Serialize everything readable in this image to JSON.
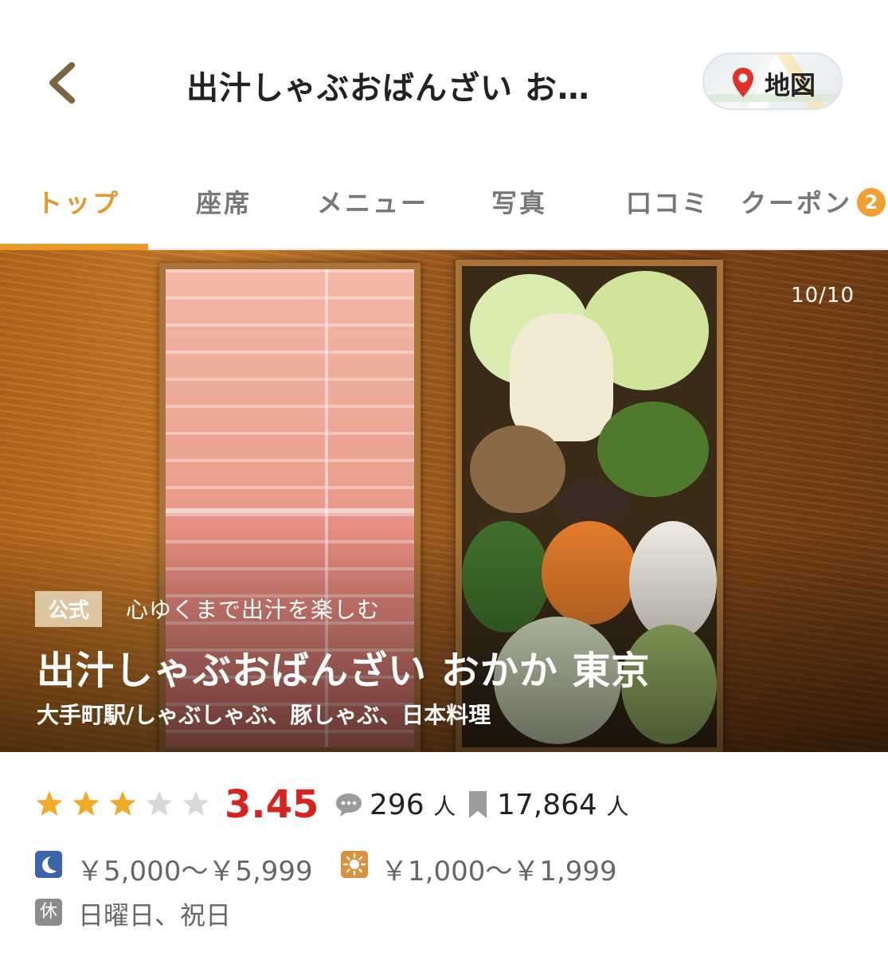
{
  "header": {
    "title": "出汁しゃぶおばんざい お…",
    "map_label": "地図"
  },
  "tabs": [
    {
      "label": "トップ",
      "active": true
    },
    {
      "label": "座席"
    },
    {
      "label": "メニュー"
    },
    {
      "label": "写真"
    },
    {
      "label": "口コミ"
    },
    {
      "label": "クーポン",
      "badge": "2"
    }
  ],
  "hero": {
    "counter": "10/10",
    "official_tag": "公式",
    "catch_copy": "心ゆくまで出汁を楽しむ",
    "name": "出汁しゃぶおばんざい おかか 東京",
    "subtitle": "大手町駅/しゃぶしゃぶ、豚しゃぶ、日本料理"
  },
  "rating": {
    "stars": 3,
    "max_stars": 5,
    "score": "3.45",
    "reviews": "296",
    "reviews_unit": "人",
    "saves": "17,864",
    "saves_unit": "人"
  },
  "prices": {
    "dinner": "￥5,000～￥5,999",
    "lunch": "￥1,000～￥1,999"
  },
  "closed": {
    "icon_label": "休",
    "days": "日曜日、祝日"
  },
  "colors": {
    "accent": "#e8962a",
    "score": "#d7231e",
    "star_on": "#f2a928",
    "star_off": "#d8d8d8"
  }
}
